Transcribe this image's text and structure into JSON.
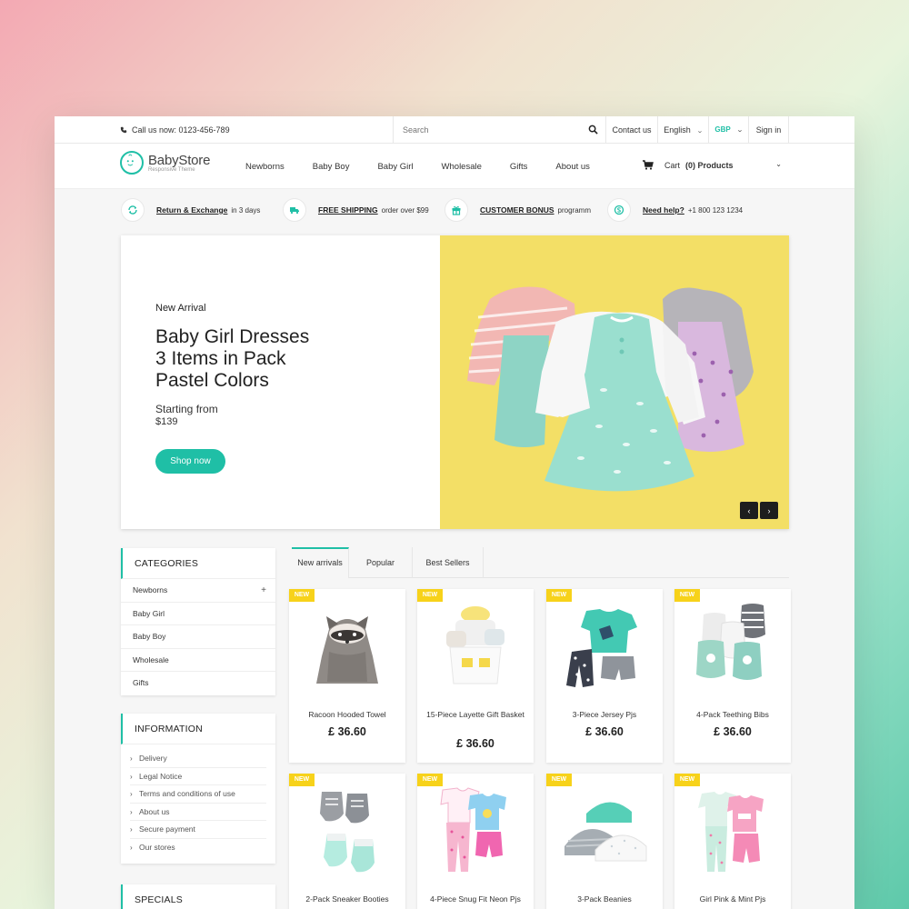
{
  "topbar": {
    "phone": "Call us now: 0123-456-789",
    "search_placeholder": "Search",
    "contact": "Contact us",
    "language": "English",
    "currency": "GBP",
    "signin": "Sign in"
  },
  "header": {
    "logo_title": "BabyStore",
    "logo_subtitle": "Responsive Theme",
    "nav": [
      "Newborns",
      "Baby Boy",
      "Baby Girl",
      "Wholesale",
      "Gifts",
      "About us"
    ],
    "cart_label": "Cart",
    "cart_count": "(0) Products"
  },
  "features": [
    {
      "icon": "refresh-icon",
      "link": "Return & Exchange",
      "text": "in 3 days"
    },
    {
      "icon": "truck-icon",
      "link": "FREE SHIPPING",
      "text": "order over $99"
    },
    {
      "icon": "gift-icon",
      "link": "CUSTOMER BONUS",
      "text": "programm"
    },
    {
      "icon": "skype-icon",
      "link": "Need help?",
      "text": "+1 800 123 1234"
    }
  ],
  "hero": {
    "eyebrow": "New Arrival",
    "title_line1": "Baby Girl Dresses",
    "title_line2": "3 Items in Pack",
    "title_line3": "Pastel Colors",
    "price_label": "Starting from",
    "price": "$139",
    "button": "Shop now",
    "prev": "‹",
    "next": "›"
  },
  "sidebar": {
    "categories_title": "CATEGORIES",
    "categories": [
      "Newborns",
      "Baby Girl",
      "Baby Boy",
      "Wholesale",
      "Gifts"
    ],
    "information_title": "INFORMATION",
    "information": [
      "Delivery",
      "Legal Notice",
      "Terms and conditions of use",
      "About us",
      "Secure payment",
      "Our stores"
    ],
    "specials_title": "SPECIALS"
  },
  "tabs": [
    "New arrivals",
    "Popular",
    "Best Sellers"
  ],
  "badge": "NEW",
  "products": [
    {
      "name": "Racoon Hooded Towel",
      "price": "£ 36.60"
    },
    {
      "name": "15-Piece Layette Gift Basket",
      "price": "£ 36.60"
    },
    {
      "name": "3-Piece Jersey Pjs",
      "price": "£ 36.60"
    },
    {
      "name": "4-Pack Teething Bibs",
      "price": "£ 36.60"
    },
    {
      "name": "2-Pack Sneaker Booties",
      "price": ""
    },
    {
      "name": "4-Piece Snug Fit Neon Pjs",
      "price": ""
    },
    {
      "name": "3-Pack Beanies",
      "price": ""
    },
    {
      "name": "Girl Pink & Mint Pjs",
      "price": ""
    }
  ],
  "colors": {
    "accent": "#1fbfa6",
    "badge": "#f7d21a",
    "hero_bg": "#f3df66"
  }
}
